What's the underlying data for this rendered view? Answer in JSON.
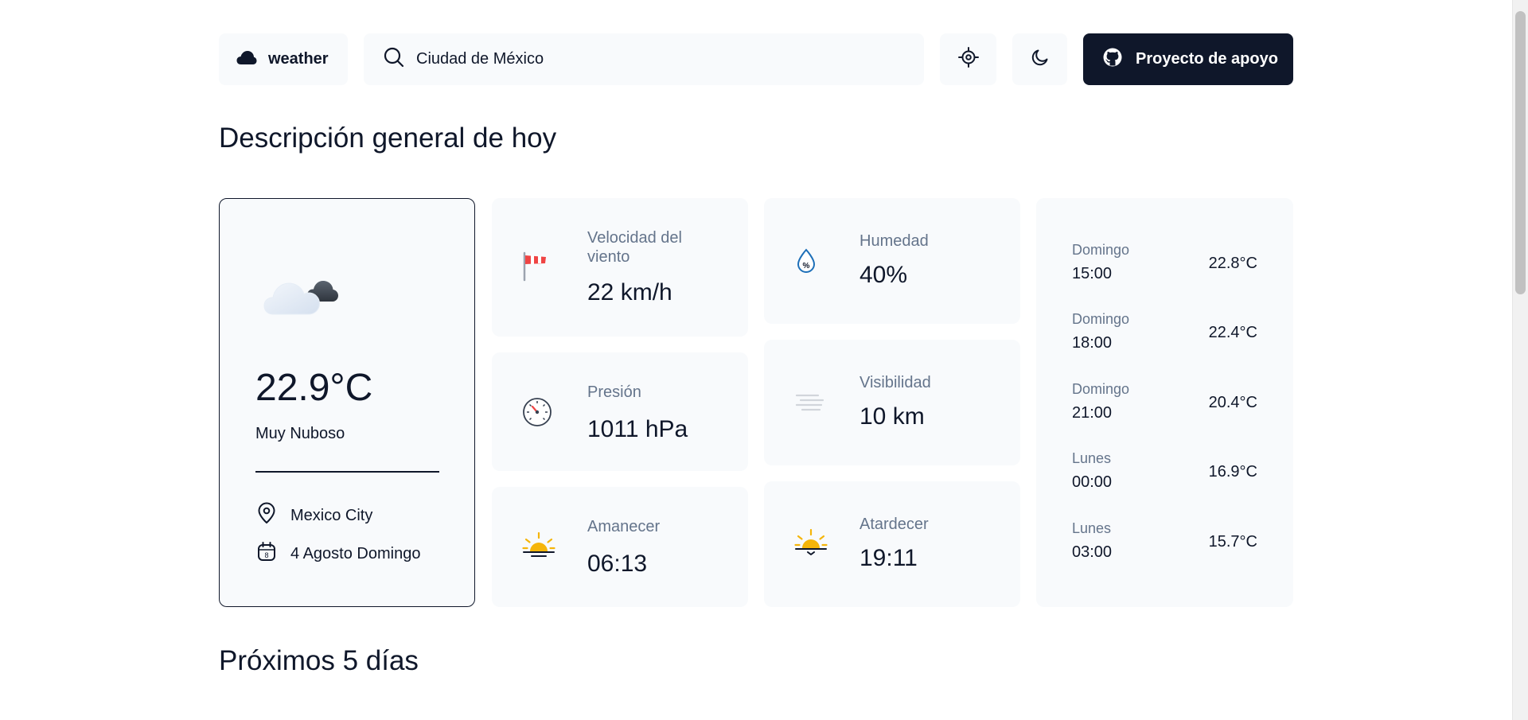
{
  "header": {
    "logo_label": "weather",
    "search_value": "Ciudad de México",
    "github_label": "Proyecto de apoyo"
  },
  "overview": {
    "title": "Descripción general de hoy",
    "current": {
      "temperature": "22.9°C",
      "condition": "Muy Nuboso",
      "city": "Mexico City",
      "date": "4 Agosto Domingo",
      "icon": "cloud-icon"
    },
    "stats": {
      "wind": {
        "label": "Velocidad del viento",
        "value": "22 km/h",
        "icon": "windsock-icon"
      },
      "humidity": {
        "label": "Humedad",
        "value": "40%",
        "icon": "humidity-drop-icon"
      },
      "pressure": {
        "label": "Presión",
        "value": "1011 hPa",
        "icon": "barometer-icon"
      },
      "visibility": {
        "label": "Visibilidad",
        "value": "10 km",
        "icon": "haze-lines-icon"
      },
      "sunrise": {
        "label": "Amanecer",
        "value": "06:13",
        "icon": "sunrise-icon"
      },
      "sunset": {
        "label": "Atardecer",
        "value": "19:11",
        "icon": "sunset-icon"
      }
    },
    "hourly": [
      {
        "day": "Domingo",
        "time": "15:00",
        "temp": "22.8°C"
      },
      {
        "day": "Domingo",
        "time": "18:00",
        "temp": "22.4°C"
      },
      {
        "day": "Domingo",
        "time": "21:00",
        "temp": "20.4°C"
      },
      {
        "day": "Lunes",
        "time": "00:00",
        "temp": "16.9°C"
      },
      {
        "day": "Lunes",
        "time": "03:00",
        "temp": "15.7°C"
      }
    ]
  },
  "next_days": {
    "title": "Próximos 5 días"
  },
  "colors": {
    "primary": "#0f172a",
    "card_bg": "#f8fafc",
    "muted_text": "#64748b",
    "sun": "#f5b50a",
    "windsock": "#ef4444",
    "humidity": "#1d6fb8"
  }
}
